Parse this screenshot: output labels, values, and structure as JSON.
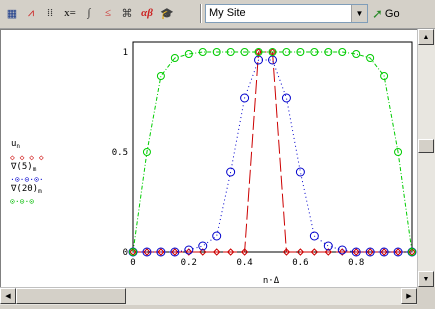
{
  "toolbar": {
    "buttons": [
      {
        "name": "calculator-toolbar-icon",
        "glyph": "▦"
      },
      {
        "name": "graph-toolbar-icon",
        "glyph": "⩘"
      },
      {
        "name": "matrix-toolbar-icon",
        "glyph": "⁞⁞"
      },
      {
        "name": "evaluation-toolbar-label",
        "glyph": "x="
      },
      {
        "name": "calculus-toolbar-icon",
        "glyph": "∫"
      },
      {
        "name": "boolean-toolbar-icon",
        "glyph": "≤"
      },
      {
        "name": "programming-toolbar-icon",
        "glyph": "⌘"
      },
      {
        "name": "greek-toolbar-label",
        "glyph": "αβ"
      },
      {
        "name": "symbolic-toolbar-icon",
        "glyph": "🎓"
      }
    ],
    "site_select_value": "My Site",
    "go_label": "Go"
  },
  "legend": {
    "line1": "u",
    "line1_sub": "n",
    "line3": "∇(5)",
    "line3_sub": "m",
    "line5": "∇(20)",
    "line5_sub": "m"
  },
  "axis": {
    "xlabel": "n·Δ",
    "x_ticks": [
      "0",
      "0.2",
      "0.4",
      "0.6",
      "0.8"
    ],
    "y_ticks": [
      "0",
      "0.5",
      "1"
    ]
  },
  "chart_data": {
    "type": "line",
    "xlabel": "n·Δ",
    "ylabel": "",
    "xlim": [
      0,
      1
    ],
    "ylim": [
      0,
      1.05
    ],
    "series": [
      {
        "name": "u_n",
        "color": "#cc0000",
        "style": "dashed-line-with-diamond-markers",
        "x": [
          0,
          0.05,
          0.1,
          0.15,
          0.2,
          0.25,
          0.3,
          0.35,
          0.4,
          0.45,
          0.5,
          0.55,
          0.6,
          0.65,
          0.7,
          0.75,
          0.8,
          0.85,
          0.9,
          0.95,
          1.0
        ],
        "y": [
          0,
          0,
          0,
          0,
          0,
          0,
          0,
          0,
          0,
          1,
          1,
          0,
          0,
          0,
          0,
          0,
          0,
          0,
          0,
          0,
          0
        ]
      },
      {
        "name": "∇(5)_m",
        "color": "#0000cc",
        "style": "dotted-line-with-circle-markers",
        "x": [
          0,
          0.05,
          0.1,
          0.15,
          0.2,
          0.25,
          0.3,
          0.35,
          0.4,
          0.45,
          0.5,
          0.55,
          0.6,
          0.65,
          0.7,
          0.75,
          0.8,
          0.85,
          0.9,
          0.95,
          1.0
        ],
        "y": [
          0,
          0,
          0,
          0,
          0.01,
          0.03,
          0.08,
          0.4,
          0.77,
          0.96,
          0.96,
          0.77,
          0.4,
          0.08,
          0.03,
          0.01,
          0,
          0,
          0,
          0,
          0
        ]
      },
      {
        "name": "∇(20)_m",
        "color": "#00cc00",
        "style": "dashdot-line-with-circle-markers",
        "x": [
          0,
          0.05,
          0.1,
          0.15,
          0.2,
          0.25,
          0.3,
          0.35,
          0.4,
          0.45,
          0.5,
          0.55,
          0.6,
          0.65,
          0.7,
          0.75,
          0.8,
          0.85,
          0.9,
          0.95,
          1.0
        ],
        "y": [
          0,
          0.5,
          0.88,
          0.97,
          0.99,
          1,
          1,
          1,
          1,
          1,
          1,
          1,
          1,
          1,
          1,
          1,
          0.99,
          0.97,
          0.88,
          0.5,
          0
        ]
      }
    ]
  }
}
